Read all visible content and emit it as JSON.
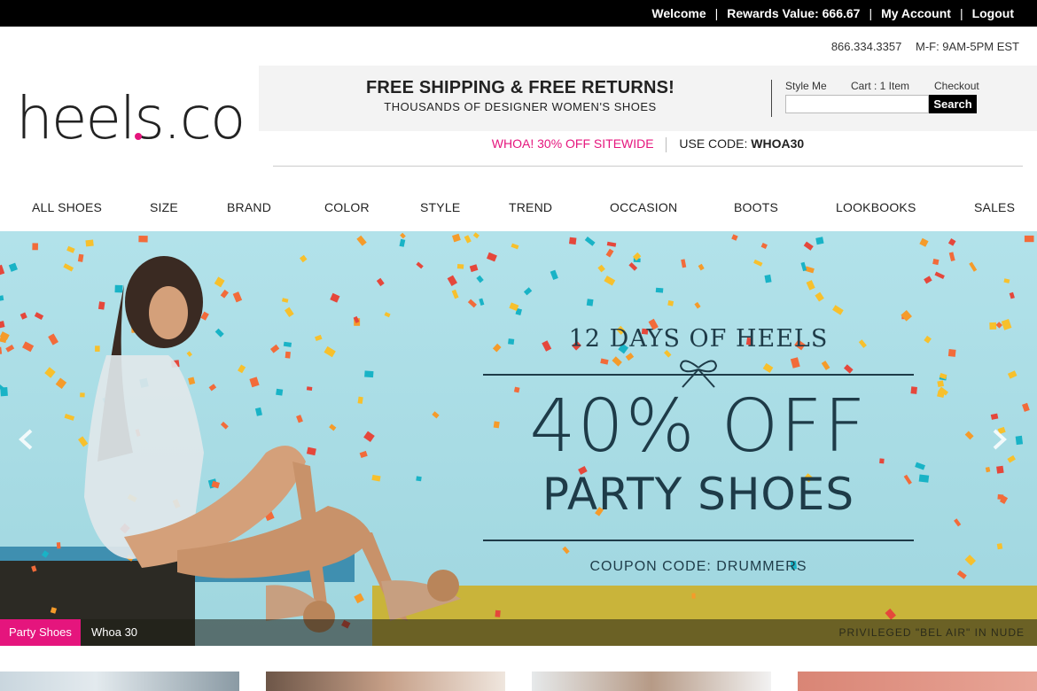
{
  "topbar": {
    "welcome": "Welcome",
    "rewards": "Rewards Value: 666.67",
    "account": "My Account",
    "logout": "Logout"
  },
  "contact": {
    "phone": "866.334.3357",
    "hours": "M-F: 9AM-5PM EST"
  },
  "logo": {
    "text": "heels.com",
    "dot_color": "#e5157d"
  },
  "promo": {
    "headline": "FREE SHIPPING & FREE RETURNS!",
    "subline": "THOUSANDS OF DESIGNER WOMEN'S SHOES"
  },
  "account_links": {
    "style_me": "Style Me",
    "cart": "Cart : 1 Item",
    "checkout": "Checkout"
  },
  "search": {
    "value": "",
    "button": "Search"
  },
  "sitewide": {
    "offer": "WHOA! 30% OFF SITEWIDE",
    "code_label": "USE CODE:",
    "code": "WHOA30"
  },
  "nav": [
    "ALL SHOES",
    "SIZE",
    "BRAND",
    "COLOR",
    "STYLE",
    "TREND",
    "OCCASION",
    "BOOTS",
    "LOOKBOOKS",
    "SALES"
  ],
  "hero": {
    "days": "12 DAYS OF HEELS",
    "discount": "40% OFF",
    "category": "PARTY SHOES",
    "coupon": "COUPON CODE: DRUMMERS",
    "caption": "PRIVILEGED \"BEL AIR\" IN NUDE",
    "tabs": [
      "Party Shoes",
      "Whoa 30"
    ],
    "active_tab": "Party Shoes"
  },
  "colors": {
    "accent_pink": "#e5157d",
    "hero_sky": "#a6dbe4",
    "hero_text": "#1e3b48"
  }
}
